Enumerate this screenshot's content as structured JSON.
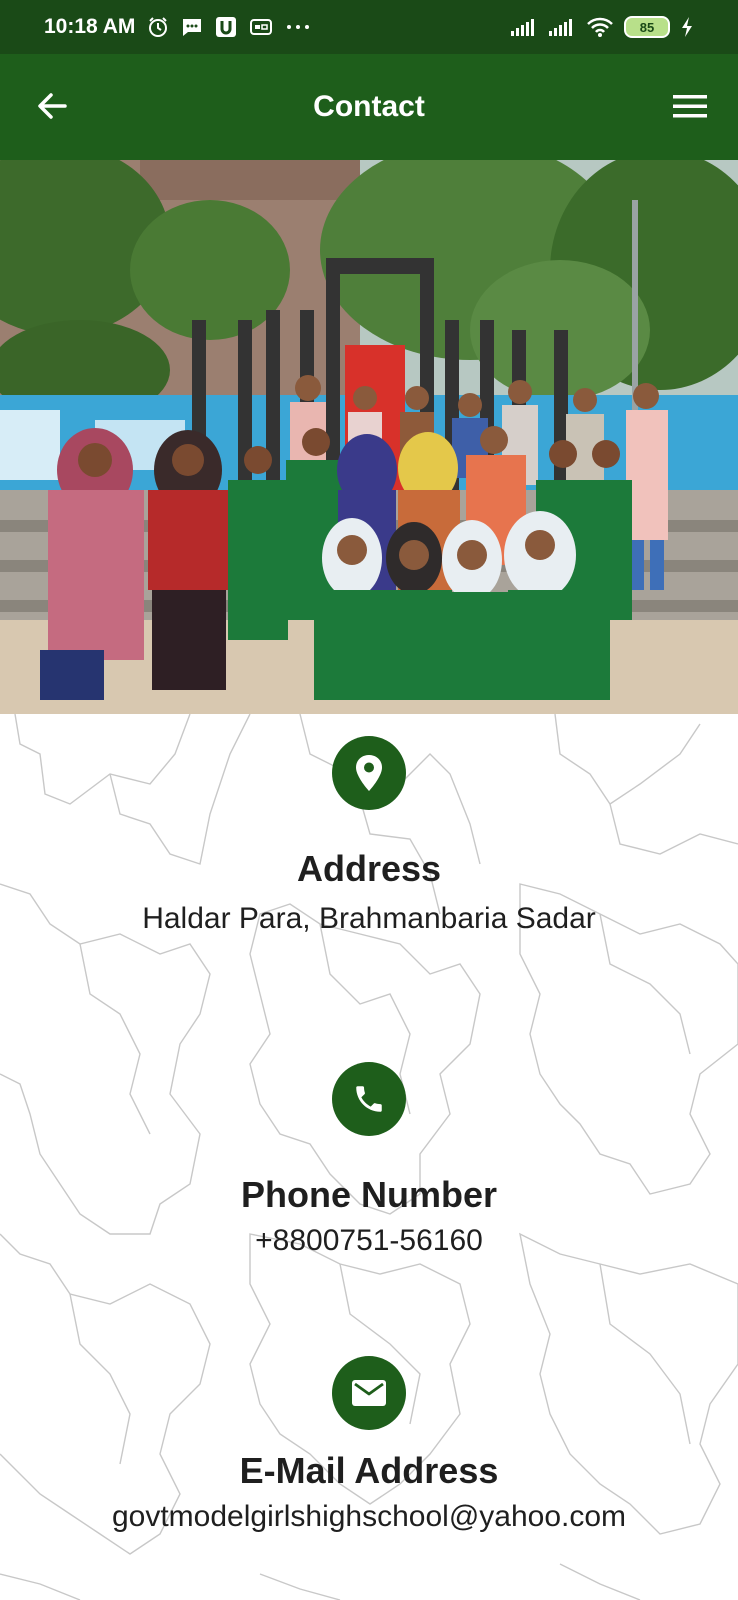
{
  "status_bar": {
    "time": "10:18 AM",
    "battery": "85",
    "icons_left": [
      "alarm-icon",
      "message-icon",
      "u-app-icon",
      "vpn-icon",
      "more-dots-icon"
    ],
    "icons_right": [
      "signal-icon",
      "signal-icon",
      "wifi-icon",
      "battery-icon",
      "charging-icon"
    ]
  },
  "app_bar": {
    "title": "Contact",
    "back_icon": "arrow-back-icon",
    "menu_icon": "hamburger-menu-icon"
  },
  "hero": {
    "description_icon": "group-photo"
  },
  "contact": {
    "address": {
      "icon": "location-pin-icon",
      "title": "Address",
      "value": "Haldar Para, Brahmanbaria Sadar"
    },
    "phone": {
      "icon": "phone-icon",
      "title": "Phone Number",
      "value": "+8800751-56160"
    },
    "email": {
      "icon": "email-icon",
      "title": "E-Mail Address",
      "value": "govtmodelgirlshighschool@yahoo.com"
    }
  },
  "colors": {
    "status_bar": "#1a4a17",
    "app_bar": "#1e5e1b",
    "icon_circle": "#1e5e1b",
    "text": "#1f1f1f"
  }
}
